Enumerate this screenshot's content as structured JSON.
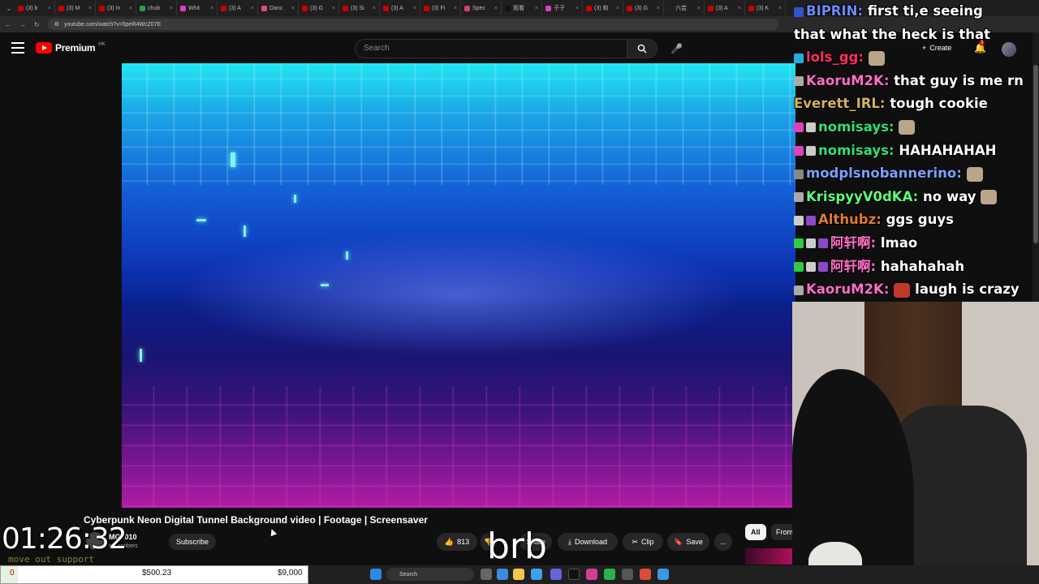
{
  "browser": {
    "tabs": [
      "(3) b",
      "(3) M",
      "(3) In",
      "chub",
      "Whit",
      "(3) A",
      "Danc",
      "(3) G",
      "(3) Si",
      "(3) A",
      "(3) Fi",
      "Spec",
      "观看",
      "子子",
      "(3) 和",
      "(3) G",
      "六芸",
      "(3) A",
      "(3) K"
    ],
    "url": "youtube.com/watch?v=5peR4WcZ07E"
  },
  "youtube": {
    "logo": "Premium",
    "region": "HK",
    "search_placeholder": "Search",
    "create_label": "Create",
    "notification_count": "3"
  },
  "video": {
    "title": "Cyberpunk Neon Digital Tunnel Background video | Footage | Screensaver",
    "channel": "MG1010",
    "subscribers": "subscribers",
    "subscribe_label": "Subscribe",
    "likes": "813",
    "share_label": "Share",
    "download_label": "Download",
    "clip_label": "Clip",
    "save_label": "Save",
    "more_label": "...",
    "chips": {
      "all": "All",
      "from": "From"
    }
  },
  "stream": {
    "timer": "01:26:32",
    "support_text": "move out support",
    "status": "brb",
    "goal": {
      "start": "0",
      "current": "$500.23",
      "target": "$9,000",
      "fraction": 0.056
    }
  },
  "chat": [
    {
      "user": "BIPRIN",
      "color": "#6b8cff",
      "msg": "first ti,e seeing",
      "badges": [
        "#3355cc"
      ]
    },
    {
      "user": "",
      "color": "#ffffff",
      "msg": "that what the heck is that",
      "badges": []
    },
    {
      "user": "lols_gg",
      "color": "#ff2e63",
      "msg": "",
      "badges": [
        "#2aa9e0"
      ],
      "emote": true
    },
    {
      "user": "KaoruM2K",
      "color": "#ff6ec7",
      "msg": "that guy is me rn",
      "badges": [
        "#aaaaaa"
      ]
    },
    {
      "user": "Everett_IRL",
      "color": "#d4b25a",
      "msg": "tough cookie",
      "badges": []
    },
    {
      "user": "nomisays",
      "color": "#2fe07a",
      "msg": "",
      "badges": [
        "#e040c0",
        "#cccccc"
      ],
      "emote": true
    },
    {
      "user": "nomisays",
      "color": "#2fe07a",
      "msg": "HAHAHAHAH",
      "badges": [
        "#e040c0",
        "#cccccc"
      ]
    },
    {
      "user": "modplsnobannerino",
      "color": "#7aa0ff",
      "msg": "",
      "badges": [
        "#888888"
      ],
      "emote": true
    },
    {
      "user": "KrispyyV0dKA",
      "color": "#5cff7a",
      "msg": "no way",
      "badges": [
        "#aaaaaa"
      ],
      "emote": true
    },
    {
      "user": "Althubz",
      "color": "#e07a2e",
      "msg": "ggs guys",
      "badges": [
        "#cccccc",
        "#8a4ac8"
      ]
    },
    {
      "user": "阿轩啊",
      "color": "#ff6ec7",
      "msg": "lmao",
      "badges": [
        "#2ecc40",
        "#cccccc",
        "#8a4ac8"
      ]
    },
    {
      "user": "阿轩啊",
      "color": "#ff6ec7",
      "msg": "hahahahah",
      "badges": [
        "#2ecc40",
        "#cccccc",
        "#8a4ac8"
      ]
    },
    {
      "user": "KaoruM2K",
      "color": "#ff6ec7",
      "msg": "laugh is crazy",
      "badges": [
        "#aaaaaa"
      ],
      "emote_before_msg": true
    }
  ],
  "taskbar": {
    "search_placeholder": "Search"
  }
}
